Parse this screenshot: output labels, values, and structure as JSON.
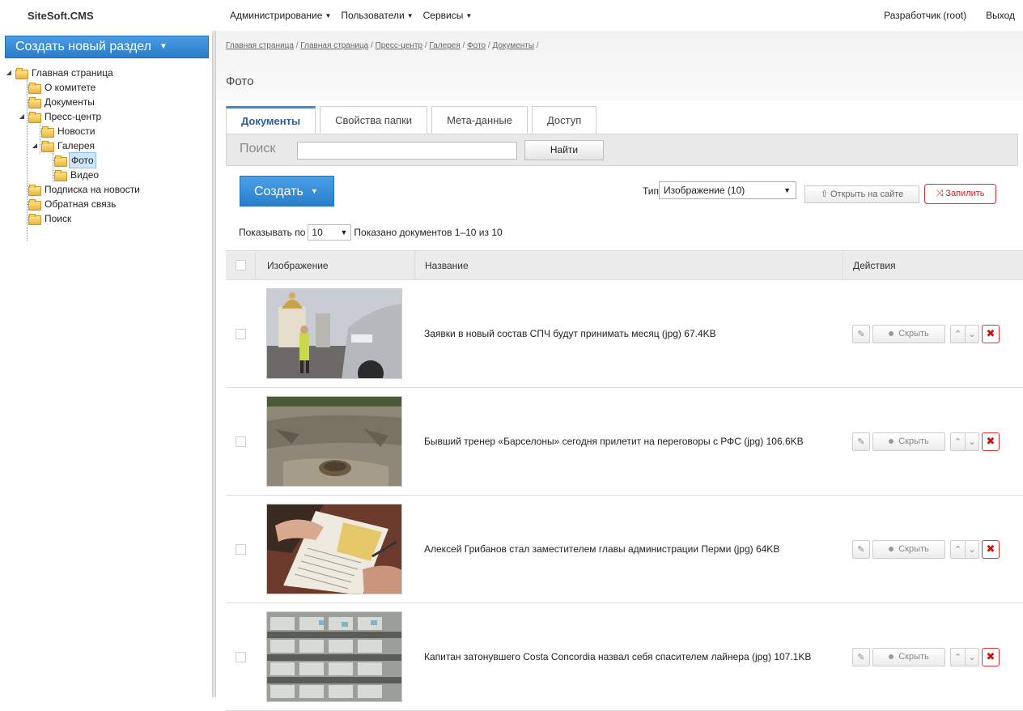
{
  "app": {
    "logo": "SiteSoft.CMS"
  },
  "topmenu": [
    {
      "label": "Администрирование"
    },
    {
      "label": "Пользователи"
    },
    {
      "label": "Сервисы"
    }
  ],
  "user": {
    "name": "Разработчик (root)",
    "logout": "Выход"
  },
  "sidebar": {
    "create_section": "Создать новый раздел",
    "tree": [
      {
        "label": "Главная страница"
      },
      {
        "label": "О комитете"
      },
      {
        "label": "Документы"
      },
      {
        "label": "Пресс-центр"
      },
      {
        "label": "Новости"
      },
      {
        "label": "Галерея"
      },
      {
        "label": "Фото"
      },
      {
        "label": "Видео"
      },
      {
        "label": "Подписка на новости"
      },
      {
        "label": "Обратная связь"
      },
      {
        "label": "Поиск"
      }
    ]
  },
  "breadcrumb": [
    {
      "label": "Главная страница"
    },
    {
      "label": "Главная страница"
    },
    {
      "label": "Пресс-центр"
    },
    {
      "label": "Галерея"
    },
    {
      "label": "Фото"
    },
    {
      "label": "Документы"
    }
  ],
  "page_title": "Фото",
  "tabs": [
    {
      "label": "Документы"
    },
    {
      "label": "Свойства папки"
    },
    {
      "label": "Мета-данные"
    },
    {
      "label": "Доступ"
    }
  ],
  "search": {
    "label": "Поиск",
    "value": "",
    "button": "Найти"
  },
  "toolbar": {
    "create": "Создать",
    "type_label": "Тип",
    "type_value": "Изображение (10)",
    "open_site": "Открыть на сайте",
    "pin": "Запилить"
  },
  "paging": {
    "show_prefix": "Показывать по",
    "per_page": "10",
    "shown": "Показано документов 1–10 из 10"
  },
  "grid": {
    "headers": {
      "image": "Изображение",
      "name": "Название",
      "actions": "Действия"
    },
    "hide_label": "Скрыть",
    "rows": [
      {
        "title": "Заявки в новый состав СПЧ будут принимать месяц (jpg) 67.4KB"
      },
      {
        "title": "Бывший тренер «Барселоны» сегодня прилетит на переговоры с РФС (jpg) 106.6KB"
      },
      {
        "title": "Алексей Грибанов стал заместителем главы администрации Перми (jpg) 64KB"
      },
      {
        "title": "Капитан затонувшего Costa Concordia назвал себя спасителем лайнера (jpg) 107.1KB"
      }
    ]
  },
  "colors": {
    "accent": "#2a7cc8",
    "danger": "#cc2222",
    "selected": "#cde6fb"
  }
}
